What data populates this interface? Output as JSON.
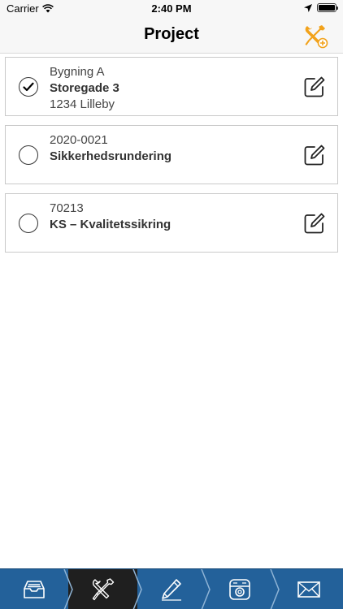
{
  "status_bar": {
    "carrier": "Carrier",
    "time": "2:40 PM"
  },
  "nav": {
    "title": "Project"
  },
  "projects": [
    {
      "line1": "Bygning A",
      "line2": "Storegade 3",
      "line3": "1234 Lilleby",
      "selected": true
    },
    {
      "line1": "2020-0021",
      "line2": "Sikkerhedsrundering",
      "line3": "",
      "selected": false
    },
    {
      "line1": "70213",
      "line2": "KS – Kvalitetssikring",
      "line3": "",
      "selected": false
    }
  ],
  "tab_bar": {
    "active_index": 1,
    "tabs": [
      "inbox-icon",
      "tools-icon",
      "pencil-icon",
      "camera-icon",
      "mail-icon"
    ]
  },
  "colors": {
    "accent_orange": "#f2a21b",
    "tab_bar_blue": "#23619a",
    "tab_active": "#1f1f1f"
  }
}
